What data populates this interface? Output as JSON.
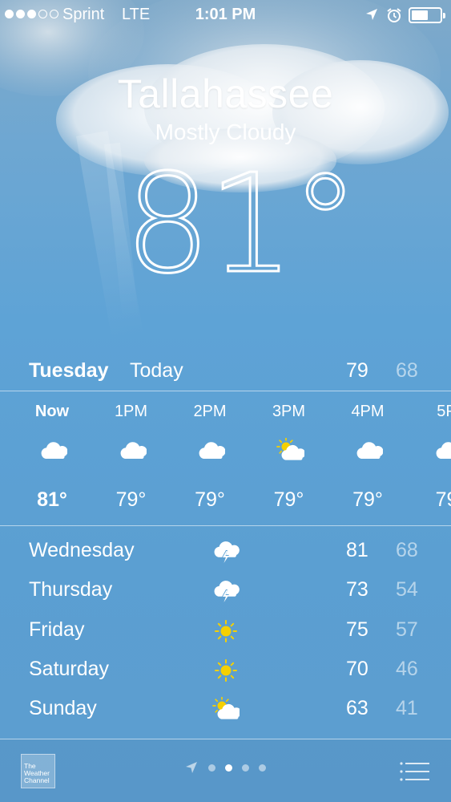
{
  "status_bar": {
    "signal_dots": [
      true,
      true,
      true,
      false,
      false
    ],
    "carrier": "Sprint",
    "network": "LTE",
    "time": "1:01 PM",
    "battery_level": 0.6
  },
  "location": {
    "city": "Tallahassee",
    "condition": "Mostly Cloudy",
    "temperature": "81°"
  },
  "today": {
    "day": "Tuesday",
    "label": "Today",
    "high": "79",
    "low": "68"
  },
  "hourly": [
    {
      "time": "Now",
      "icon": "cloud-icon",
      "temp": "81°"
    },
    {
      "time": "1PM",
      "icon": "cloud-icon",
      "temp": "79°"
    },
    {
      "time": "2PM",
      "icon": "cloud-icon",
      "temp": "79°"
    },
    {
      "time": "3PM",
      "icon": "partly-sunny-icon",
      "temp": "79°"
    },
    {
      "time": "4PM",
      "icon": "cloud-icon",
      "temp": "79°"
    },
    {
      "time": "5P",
      "icon": "cloud-icon",
      "temp": "79"
    }
  ],
  "daily": [
    {
      "day": "Wednesday",
      "icon": "thunderstorm-icon",
      "high": "81",
      "low": "68"
    },
    {
      "day": "Thursday",
      "icon": "thunderstorm-icon",
      "high": "73",
      "low": "54"
    },
    {
      "day": "Friday",
      "icon": "sun-icon",
      "high": "75",
      "low": "57"
    },
    {
      "day": "Saturday",
      "icon": "sun-icon",
      "high": "70",
      "low": "46"
    },
    {
      "day": "Sunday",
      "icon": "partly-sunny-icon",
      "high": "63",
      "low": "41"
    }
  ],
  "bottom_bar": {
    "logo_lines": [
      "The",
      "Weather",
      "Channel"
    ],
    "page_count": 3,
    "active_page": 1
  },
  "colors": {
    "sky_top": "#7fa9c9",
    "sky": "#5ea3d6",
    "sun": "#f5d000"
  }
}
